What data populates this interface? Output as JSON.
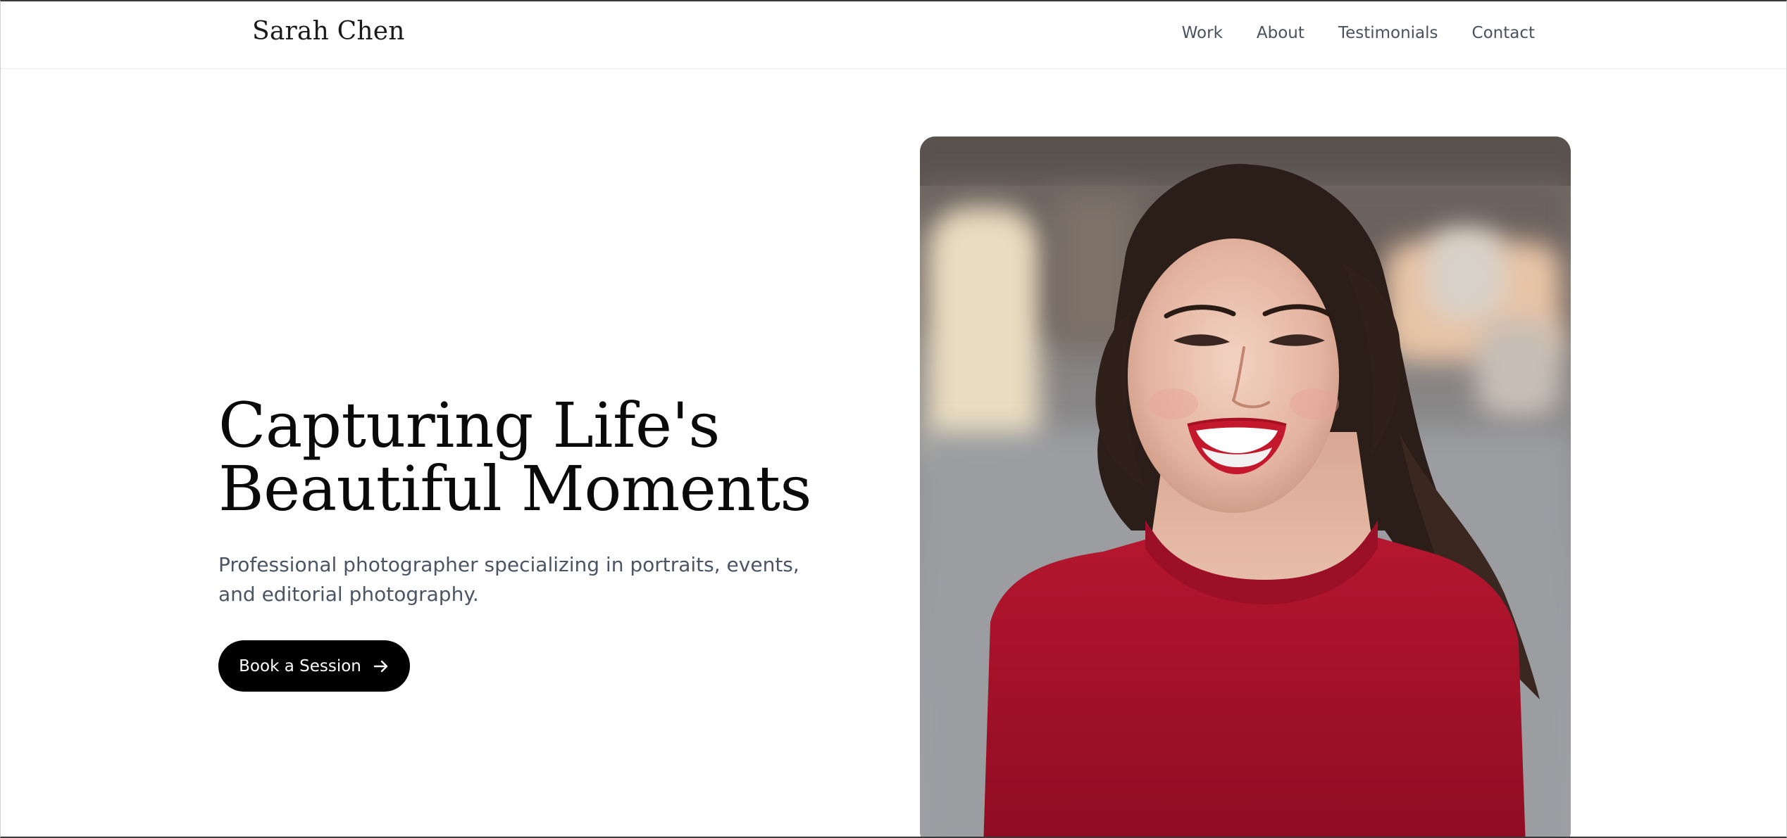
{
  "header": {
    "brand": "Sarah Chen",
    "nav": [
      "Work",
      "About",
      "Testimonials",
      "Contact"
    ]
  },
  "hero": {
    "title_line1": "Capturing Life's",
    "title_line2": "Beautiful Moments",
    "subtitle": "Professional photographer specializing in portraits, events, and editorial photography.",
    "cta_label": "Book a Session",
    "cta_icon": "arrow-right-icon",
    "image_icon": "portrait-photo"
  },
  "colors": {
    "text_primary": "#0a0a0a",
    "text_secondary": "#4b5563",
    "nav_text": "#4a5160",
    "button_bg": "#000000",
    "button_text": "#ffffff",
    "sweater": "#a3122c"
  }
}
